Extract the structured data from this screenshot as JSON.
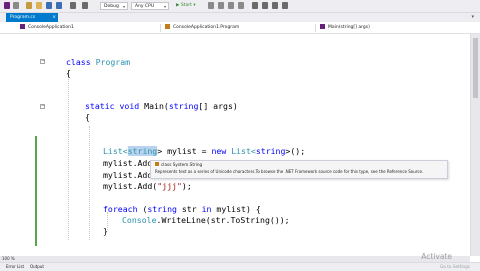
{
  "toolbar": {
    "config": "Debug",
    "platform": "Any CPU",
    "start_label": "▶ Start ▾"
  },
  "tab": {
    "label": "Program.cs",
    "close": "×"
  },
  "navbar": {
    "project": "ConsoleApplication1",
    "class": "ConsoleApplication1.Program",
    "member": "Main(string[] args)"
  },
  "code": {
    "l1_kw": "class",
    "l1_type": "Program",
    "l2": "{",
    "l3_kw": "static void",
    "l3_rest_a": " Main(",
    "l3_kw2": "string",
    "l3_rest_b": "[] args)",
    "l4": "{",
    "l5_type": "List<",
    "l5_sel": "string",
    "l5_mid": "> mylist = ",
    "l5_kw": "new",
    "l5_type2": " List<",
    "l5_kw2": "string",
    "l5_end": ">();",
    "l6": "mylist.Add",
    "l7": "mylist.Add",
    "l8_a": "mylist.Add(",
    "l8_str": "\"jjj\"",
    "l8_b": ");",
    "l9_kw": "foreach",
    "l9_a": " (",
    "l9_kw2": "string",
    "l9_b": " str ",
    "l9_kw3": "in",
    "l9_c": " mylist) {",
    "l10_type": "Console",
    "l10_rest": ".WriteLine(str.ToString());",
    "l11": "}"
  },
  "tooltip": {
    "signature": "class System.String",
    "description": "Represents text as a series of Unicode characters.To browse the .NET Framework source code for this type, see the Reference Source."
  },
  "scroll": {
    "zoom": "100 %"
  },
  "status": {
    "item1": "Error List",
    "item2": "Output"
  },
  "watermark": {
    "line1": "Activate",
    "line2": "Go to Settings"
  },
  "colors": {
    "accent": "#007acc",
    "keyword": "#0000ff",
    "type": "#2b91af",
    "string": "#a31515",
    "change_bar": "#57a64a"
  }
}
